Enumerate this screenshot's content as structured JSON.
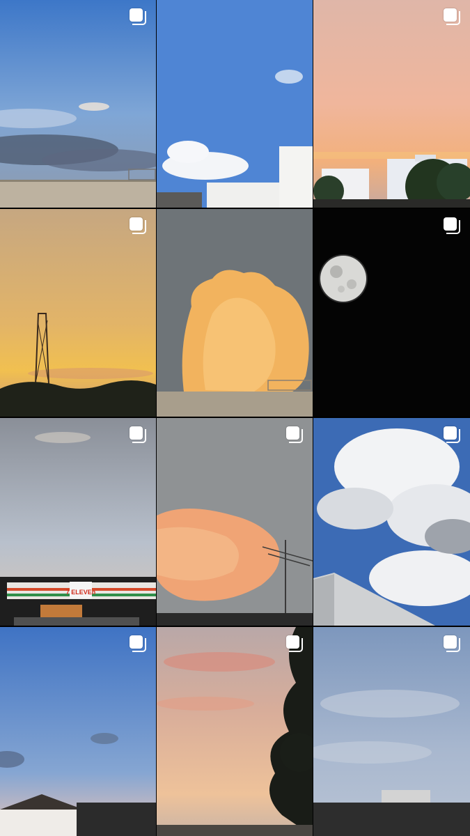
{
  "grid": {
    "posts": [
      {
        "scene": "blue-sky-warehouse-roof",
        "multi": true
      },
      {
        "scene": "blue-sky-white-building",
        "multi": false
      },
      {
        "scene": "pink-sunset-buildings",
        "multi": true
      },
      {
        "scene": "golden-sunset-tower",
        "multi": true
      },
      {
        "scene": "orange-cumulus-cloud",
        "multi": false
      },
      {
        "scene": "full-moon-night",
        "multi": true
      },
      {
        "scene": "dusk-sky-7-eleven",
        "multi": true
      },
      {
        "scene": "peach-cloud-antenna",
        "multi": true
      },
      {
        "scene": "white-cumulus-clouds",
        "multi": true
      },
      {
        "scene": "evening-blue-sky-houses",
        "multi": true
      },
      {
        "scene": "pink-sunset-tree",
        "multi": true
      },
      {
        "scene": "grey-blue-sky-rooftops",
        "multi": true
      }
    ],
    "store_sign": "7 ELEVEn"
  },
  "colors": {
    "gridline": "#000000",
    "icon": "#ffffff"
  }
}
